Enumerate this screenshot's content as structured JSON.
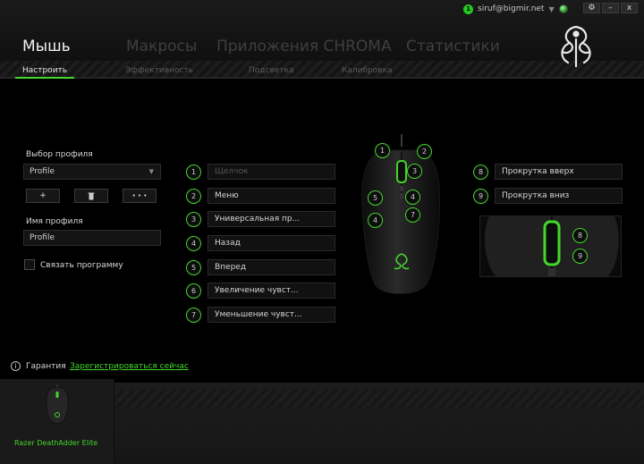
{
  "user": {
    "badge_count": "1",
    "email": "siruf@bigmir.net"
  },
  "window": {
    "settings_icon": "⚙",
    "minimize_icon": "–",
    "close_icon": "x"
  },
  "main_tabs": [
    "Мышь",
    "Макросы",
    "Приложения CHROMA",
    "Статистики"
  ],
  "sub_tabs": [
    "Настроить",
    "Эффективность",
    "Подсветка",
    "Калибровка"
  ],
  "profile": {
    "select_label": "Выбор профиля",
    "selected": "Profile",
    "add_label": "+",
    "delete_icon": "trash-icon",
    "more_label": "• • •",
    "name_label": "Имя профиля",
    "name_value": "Profile",
    "link_program_label": "Связать программу"
  },
  "buttons": [
    {
      "num": "1",
      "label": "Щелчок"
    },
    {
      "num": "2",
      "label": "Меню"
    },
    {
      "num": "3",
      "label": "Универсальная пр..."
    },
    {
      "num": "4",
      "label": "Назад"
    },
    {
      "num": "5",
      "label": "Вперед"
    },
    {
      "num": "6",
      "label": "Увеличение чувст..."
    },
    {
      "num": "7",
      "label": "Уменьшение чувст..."
    }
  ],
  "scroll_buttons": [
    {
      "num": "8",
      "label": "Прокрутка вверх"
    },
    {
      "num": "9",
      "label": "Прокрутка вниз"
    }
  ],
  "mouse_labels": [
    "1",
    "2",
    "3",
    "4",
    "5",
    "4",
    "7"
  ],
  "side_labels": [
    "8",
    "9"
  ],
  "warranty": {
    "label": "Гарантия",
    "register_link": "Зарегистрироваться сейчас"
  },
  "device": {
    "name": "Razer DeathAdder Elite"
  },
  "colors": {
    "accent": "#44d62c",
    "background": "#000000"
  }
}
